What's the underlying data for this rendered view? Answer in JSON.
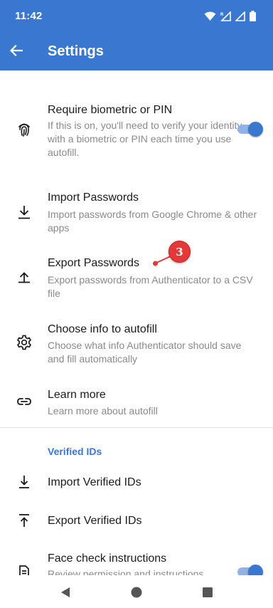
{
  "status_bar": {
    "time": "11:42"
  },
  "app_bar": {
    "title": "Settings"
  },
  "items": {
    "require_biometric": {
      "title": "Require biometric or PIN",
      "subtitle": "If this is on, you'll need to verify your identity with a biometric or PIN each time you use autofill.",
      "toggle_on": true
    },
    "import_passwords": {
      "title": "Import Passwords",
      "subtitle": "Import passwords from Google Chrome & other apps"
    },
    "export_passwords": {
      "title": "Export Passwords",
      "subtitle": "Export passwords from Authenticator to a CSV file"
    },
    "choose_info": {
      "title": "Choose info to autofill",
      "subtitle": "Choose what info Authenticator should save and fill automatically"
    },
    "learn_more": {
      "title": "Learn more",
      "subtitle": "Learn more about autofill"
    }
  },
  "verified_ids": {
    "section_title": "Verified IDs",
    "import_title": "Import Verified IDs",
    "export_title": "Export Verified IDs",
    "face_check_title": "Face check instructions",
    "face_check_subtitle": "Review permission and instructions",
    "face_check_toggle_on": true
  },
  "annotation": {
    "marker_label": "3"
  },
  "colors": {
    "primary": "#3a77d1",
    "toggle_track": "#8fb3e6",
    "annotation_red": "#e53838"
  },
  "icons": [
    "back-arrow-icon",
    "wifi-icon",
    "signal-icon",
    "battery-icon",
    "fingerprint-icon",
    "download-icon",
    "upload-icon",
    "gear-icon",
    "link-icon",
    "import-icon",
    "export-icon",
    "document-icon",
    "nav-back-icon",
    "nav-home-icon",
    "nav-recents-icon"
  ]
}
